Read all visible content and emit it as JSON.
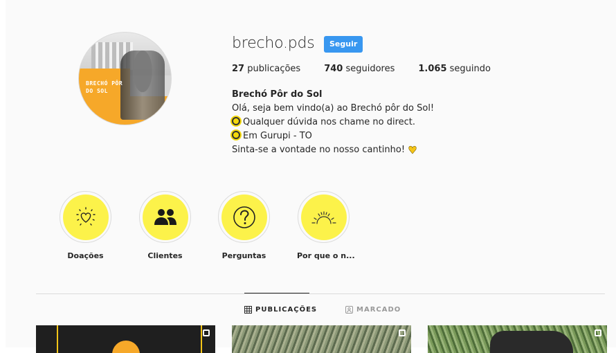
{
  "profile": {
    "username": "brecho.pds",
    "follow_label": "Seguir",
    "avatar_text": [
      "BRECHÓ PÔR",
      "DO SOL"
    ],
    "stats": [
      {
        "value": "27",
        "label": "publicações"
      },
      {
        "value": "740",
        "label": "seguidores"
      },
      {
        "value": "1.065",
        "label": "seguindo"
      }
    ],
    "bio": {
      "name": "Brechó Pôr do Sol",
      "lines": [
        "Olá, seja bem vindo(a) ao Brechó pôr do Sol!",
        "Qualquer dúvida nos chame no direct.",
        "Em Gurupi - TO",
        "Sinta-se a vontade no nosso cantinho!"
      ]
    }
  },
  "highlights": [
    {
      "label": "Doações",
      "icon": "heart-icon"
    },
    {
      "label": "Clientes",
      "icon": "people-icon"
    },
    {
      "label": "Perguntas",
      "icon": "question-icon"
    },
    {
      "label": "Por que o n...",
      "icon": "sunrise-icon"
    }
  ],
  "tabs": [
    {
      "label": "PUBLICAÇÕES",
      "icon": "grid-icon",
      "active": true
    },
    {
      "label": "MARCADO",
      "icon": "tag-icon",
      "active": false
    }
  ],
  "colors": {
    "follow_button": "#3897f0",
    "highlight_fill": "#fcf24a",
    "accent_orange": "#f6a829"
  }
}
